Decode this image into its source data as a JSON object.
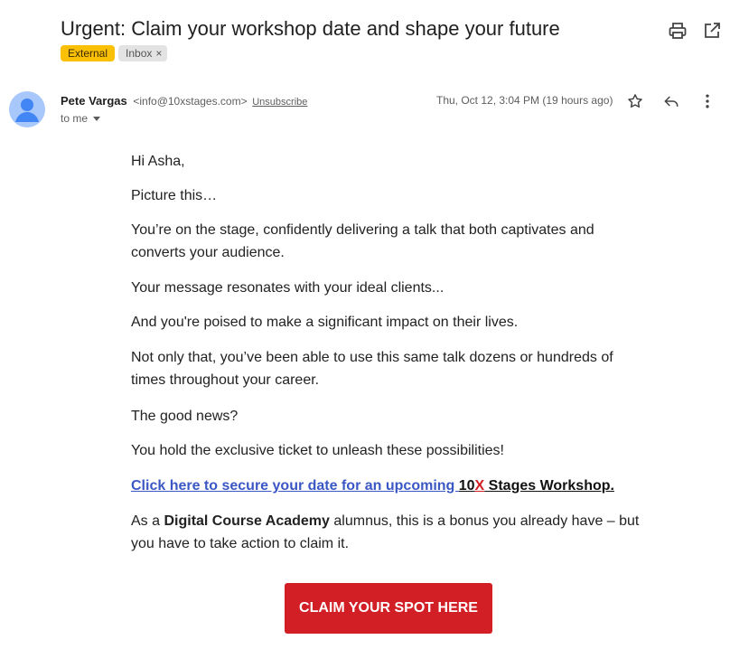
{
  "email": {
    "subject": "Urgent: Claim your workshop date and shape your future",
    "labels": {
      "external": "External",
      "inbox": "Inbox",
      "inbox_remove": "×"
    },
    "sender": {
      "name": "Pete Vargas",
      "email": "<info@10xstages.com>",
      "unsubscribe": "Unsubscribe",
      "to": "to me"
    },
    "date": "Thu, Oct 12, 3:04 PM (19 hours ago)",
    "icons": {
      "print": "print-icon",
      "open_new_window": "open-in-new-window-icon",
      "star": "star-icon",
      "reply": "reply-icon",
      "more": "more-vert-icon",
      "avatar": "avatar-icon"
    }
  },
  "body": {
    "greeting": "Hi Asha,",
    "p1": "Picture this…",
    "p2": "You’re on the stage, confidently delivering a talk that both captivates and converts your audience.",
    "p3": "Your message resonates with your ideal clients...",
    "p4": "And you're poised to make a significant impact on their lives.",
    "p5": "Not only that, you’ve been able to use this same talk dozens or hundreds of times throughout your career.",
    "p6": "The good news?",
    "p7": "You hold the exclusive ticket to unleash these possibilities!",
    "link": {
      "text": "Click here to secure your date for an upcoming ",
      "ten": "10",
      "x": "X",
      "stages": " Stages Workshop."
    },
    "p8": {
      "pre": "As a ",
      "bold": "Digital Course Academy",
      "post": " alumnus, this is a bonus you already have – but you have to take action to claim it."
    },
    "cta": "CLAIM YOUR SPOT HERE"
  },
  "colors": {
    "external_label": "#f9c006",
    "link": "#3a57c4",
    "cta": "#d21f26",
    "avatar": "#a8c7fa"
  }
}
